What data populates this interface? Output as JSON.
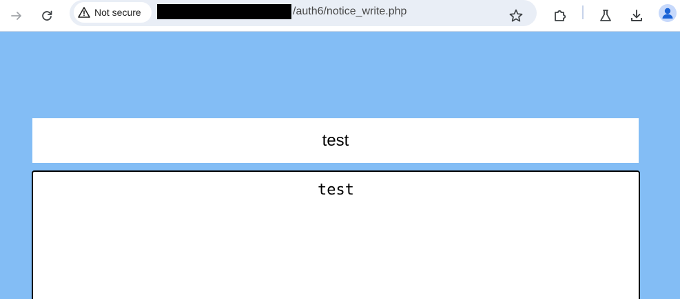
{
  "browser": {
    "security_label": "Not secure",
    "url_path": "/auth6/notice_write.php",
    "icons": {
      "forward": "arrow-right-icon",
      "reload": "reload-icon",
      "warning": "warning-triangle-icon",
      "bookmark": "star-icon",
      "extensions": "puzzle-icon",
      "labs": "flask-icon",
      "downloads": "download-icon",
      "profile": "avatar-icon"
    }
  },
  "page": {
    "background_color": "#83bdf5",
    "title_value": "test",
    "content_value": "test"
  }
}
